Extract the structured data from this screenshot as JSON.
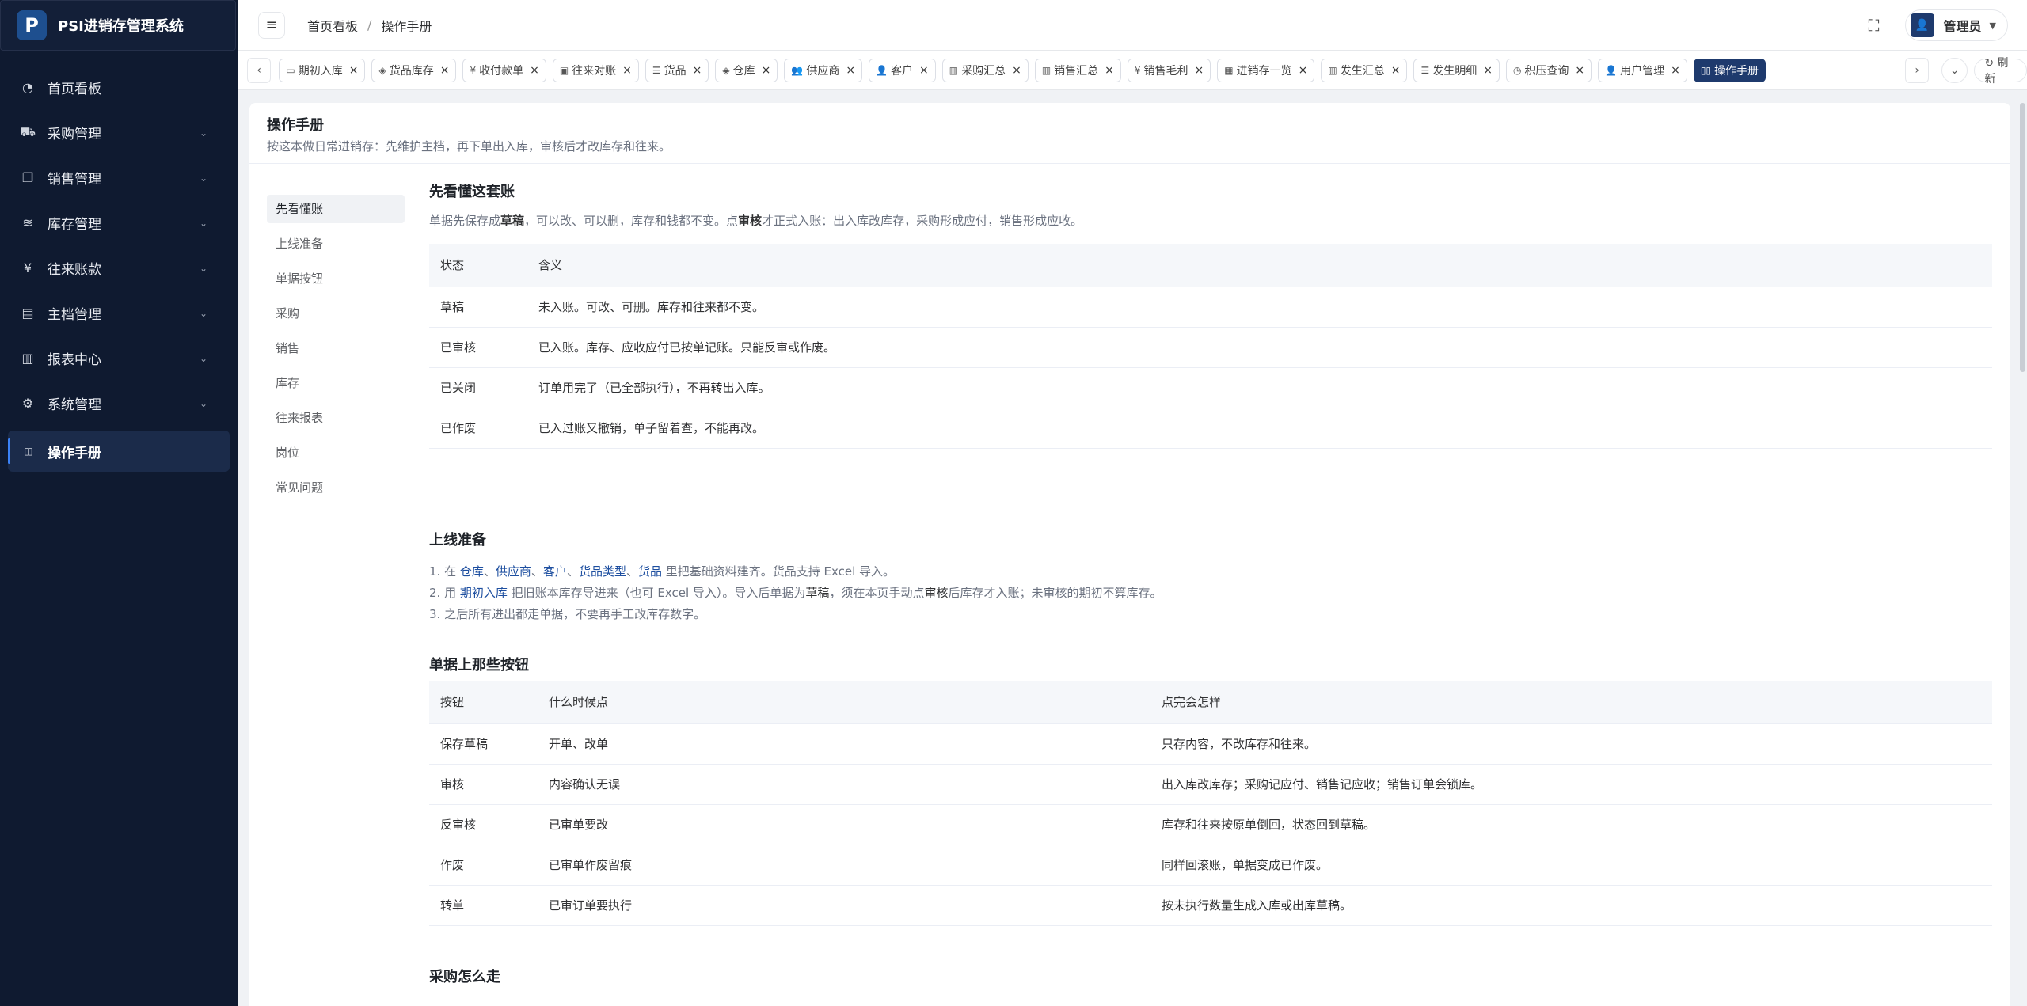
{
  "app": {
    "logo_letter": "P",
    "title": "PSI进销存管理系统"
  },
  "sidebar": {
    "items": [
      {
        "label": "首页看板",
        "icon": "dashboard-icon",
        "glyph": "◔",
        "expand": false
      },
      {
        "label": "采购管理",
        "icon": "cart-icon",
        "glyph": "⛟",
        "expand": true
      },
      {
        "label": "销售管理",
        "icon": "copy-icon",
        "glyph": "❐",
        "expand": true
      },
      {
        "label": "库存管理",
        "icon": "layers-icon",
        "glyph": "≋",
        "expand": true
      },
      {
        "label": "往来账款",
        "icon": "yen-icon",
        "glyph": "¥",
        "expand": true
      },
      {
        "label": "主档管理",
        "icon": "id-card-icon",
        "glyph": "▤",
        "expand": true
      },
      {
        "label": "报表中心",
        "icon": "bar-chart-icon",
        "glyph": "▥",
        "expand": true
      },
      {
        "label": "系统管理",
        "icon": "gear-icon",
        "glyph": "⚙",
        "expand": true
      }
    ],
    "active": {
      "label": "操作手册",
      "icon": "book-icon",
      "glyph": "▯▯"
    },
    "chevron": "⌄"
  },
  "header": {
    "breadcrumb": [
      "首页看板",
      "操作手册"
    ],
    "breadcrumb_sep": "/",
    "user_name": "管理员",
    "hamburger_glyph": "≡",
    "fullscreen_glyph": "⛶",
    "avatar_glyph": "👤",
    "caret_glyph": "▼"
  },
  "tabs": {
    "items": [
      {
        "label": "期初入库",
        "glyph": "▭"
      },
      {
        "label": "货品库存",
        "glyph": "◈"
      },
      {
        "label": "收付款单",
        "glyph": "¥"
      },
      {
        "label": "往来对账",
        "glyph": "▣"
      },
      {
        "label": "货品",
        "glyph": "☰"
      },
      {
        "label": "仓库",
        "glyph": "◈"
      },
      {
        "label": "供应商",
        "glyph": "👥"
      },
      {
        "label": "客户",
        "glyph": "👤"
      },
      {
        "label": "采购汇总",
        "glyph": "▥"
      },
      {
        "label": "销售汇总",
        "glyph": "▥"
      },
      {
        "label": "销售毛利",
        "glyph": "¥"
      },
      {
        "label": "进销存一览",
        "glyph": "▦"
      },
      {
        "label": "发生汇总",
        "glyph": "▥"
      },
      {
        "label": "发生明细",
        "glyph": "☰"
      },
      {
        "label": "积压查询",
        "glyph": "◷"
      },
      {
        "label": "用户管理",
        "glyph": "👤"
      }
    ],
    "active": {
      "label": "操作手册",
      "glyph": "▯▯"
    },
    "close_glyph": "×",
    "left_arrow": "‹",
    "right_arrow": "›",
    "dropdown": "⌄",
    "refresh_label": "↻ 刷新"
  },
  "manual": {
    "title": "操作手册",
    "subtitle": "按这本做日常进销存：先维护主档，再下单出入库，审核后才改库存和往来。",
    "toc": [
      "先看懂账",
      "上线准备",
      "单据按钮",
      "采购",
      "销售",
      "库存",
      "往来报表",
      "岗位",
      "常见问题"
    ],
    "sec1": {
      "title": "先看懂这套账",
      "desc_a": "单据先保存成",
      "desc_b": "草稿",
      "desc_c": "，可以改、可以删，库存和钱都不变。点",
      "desc_d": "审核",
      "desc_e": "才正式入账：出入库改库存，采购形成应付，销售形成应收。",
      "headers": [
        "状态",
        "含义"
      ],
      "rows": [
        [
          "草稿",
          "未入账。可改、可删。库存和往来都不变。"
        ],
        [
          "已审核",
          "已入账。库存、应收应付已按单记账。只能反审或作废。"
        ],
        [
          "已关闭",
          "订单用完了（已全部执行），不再转出入库。"
        ],
        [
          "已作废",
          "已入过账又撤销，单子留着查，不能再改。"
        ]
      ]
    },
    "sec2": {
      "title": "上线准备",
      "l1_a": "1. 在 ",
      "l1_links": [
        "仓库",
        "供应商",
        "客户",
        "货品类型",
        "货品"
      ],
      "l1_sep": "、",
      "l1_b": " 里把基础资料建齐。货品支持 Excel 导入。",
      "l2_a": "2. 用 ",
      "l2_link": "期初入库",
      "l2_b": " 把旧账本库存导进来（也可 Excel 导入）。导入后单据为",
      "l2_c": "草稿",
      "l2_d": "，须在本页手动点",
      "l2_e": "审核",
      "l2_f": "后库存才入账；未审核的期初不算库存。",
      "l3": "3. 之后所有进出都走单据，不要再手工改库存数字。"
    },
    "sec3": {
      "title": "单据上那些按钮",
      "headers": [
        "按钮",
        "什么时候点",
        "点完会怎样"
      ],
      "rows": [
        [
          "保存草稿",
          "开单、改单",
          "只存内容，不改库存和往来。"
        ],
        [
          "审核",
          "内容确认无误",
          "出入库改库存；采购记应付、销售记应收；销售订单会锁库。"
        ],
        [
          "反审核",
          "已审单要改",
          "库存和往来按原单倒回，状态回到草稿。"
        ],
        [
          "作废",
          "已审单作废留痕",
          "同样回滚账，单据变成已作废。"
        ],
        [
          "转单",
          "已审订单要执行",
          "按未执行数量生成入库或出库草稿。"
        ]
      ]
    },
    "sec4": {
      "title": "采购怎么走"
    }
  }
}
